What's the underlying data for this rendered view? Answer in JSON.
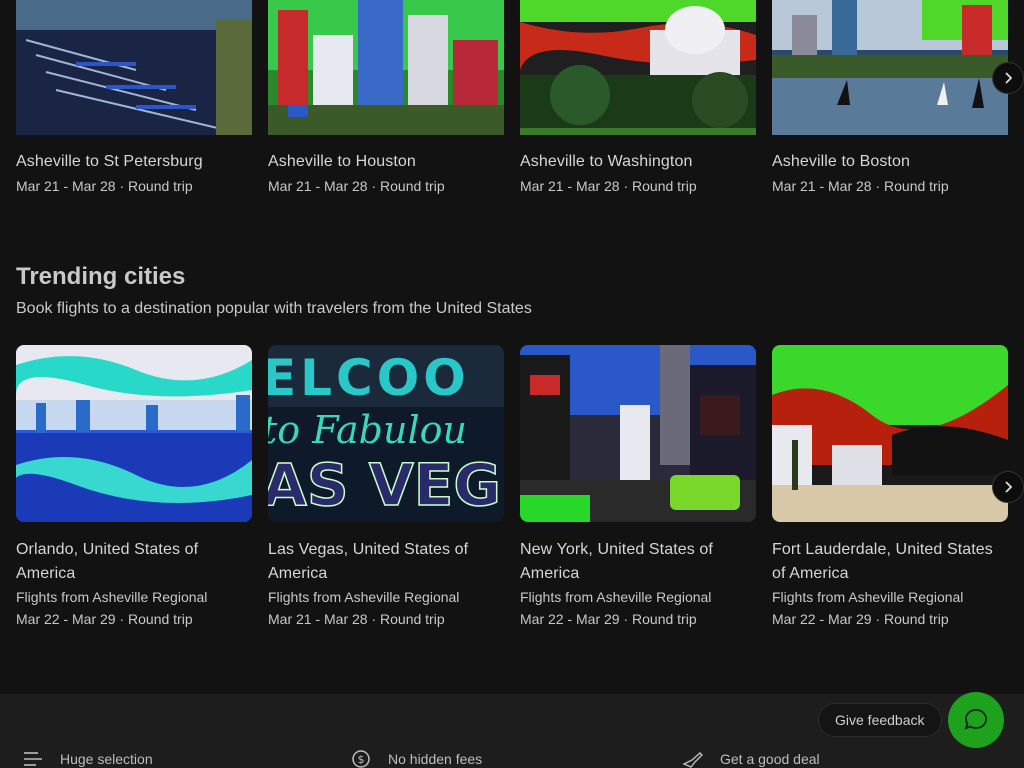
{
  "top_row": [
    {
      "title": "Asheville to St Petersburg",
      "dates": "Mar 21 - Mar 28 · Round trip",
      "scene": "marina"
    },
    {
      "title": "Asheville to Houston",
      "dates": "Mar 21 - Mar 28 · Round trip",
      "scene": "skyline"
    },
    {
      "title": "Asheville to Washington",
      "dates": "Mar 21 - Mar 28 · Round trip",
      "scene": "capitol"
    },
    {
      "title": "Asheville to Boston",
      "dates": "Mar 21 - Mar 28 · Round trip",
      "scene": "harbor"
    }
  ],
  "trending": {
    "title": "Trending cities",
    "subtitle": "Book flights to a destination popular with travelers from the United States",
    "cards": [
      {
        "title": "Orlando, United States of America",
        "from": "Flights from Asheville Regional",
        "dates": "Mar 22 - Mar 29 · Round trip",
        "scene": "lake"
      },
      {
        "title": "Las Vegas, United States of America",
        "from": "Flights from Asheville Regional",
        "dates": "Mar 21 - Mar 28 · Round trip",
        "scene": "sign"
      },
      {
        "title": "New York, United States of America",
        "from": "Flights from Asheville Regional",
        "dates": "Mar 22 - Mar 29 · Round trip",
        "scene": "street"
      },
      {
        "title": "Fort Lauderdale, United States of America",
        "from": "Flights from Asheville Regional",
        "dates": "Mar 22 - Mar 29 · Round trip",
        "scene": "beach"
      }
    ]
  },
  "vegas_sign": {
    "line1": "ELCOO",
    "line2": "to Fabulou",
    "line3": "AS VEG"
  },
  "features": [
    {
      "label": "Huge selection",
      "icon": "list-icon"
    },
    {
      "label": "No hidden fees",
      "icon": "dollar-icon"
    },
    {
      "label": "Get a good deal",
      "icon": "plane-deal-icon"
    }
  ],
  "feedback_label": "Give feedback",
  "colors": {
    "accent": "#1ea21e",
    "background": "#121212"
  }
}
